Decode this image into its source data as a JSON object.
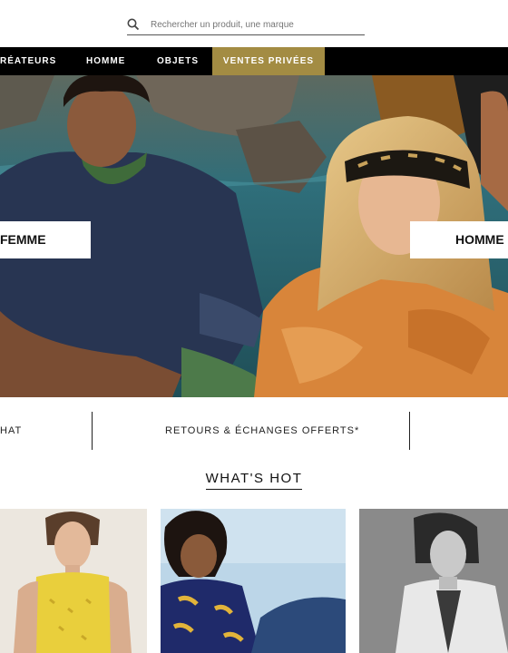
{
  "search": {
    "placeholder": "Rechercher un produit, une marque"
  },
  "nav": {
    "items": [
      {
        "label": "RÉATEURS"
      },
      {
        "label": "HOMME"
      },
      {
        "label": "OBJETS"
      },
      {
        "label": "VENTES PRIVÉES"
      }
    ]
  },
  "hero": {
    "femme_label": "FEMME",
    "homme_label": "HOMME"
  },
  "strip": {
    "left_text": "HAT",
    "center_text": "RETOURS & ÉCHANGES OFFERTS*"
  },
  "whats_hot": {
    "title": "WHAT'S HOT"
  },
  "colors": {
    "nav_bg": "#000000",
    "ventes_privees_accent": "#a38c43"
  }
}
